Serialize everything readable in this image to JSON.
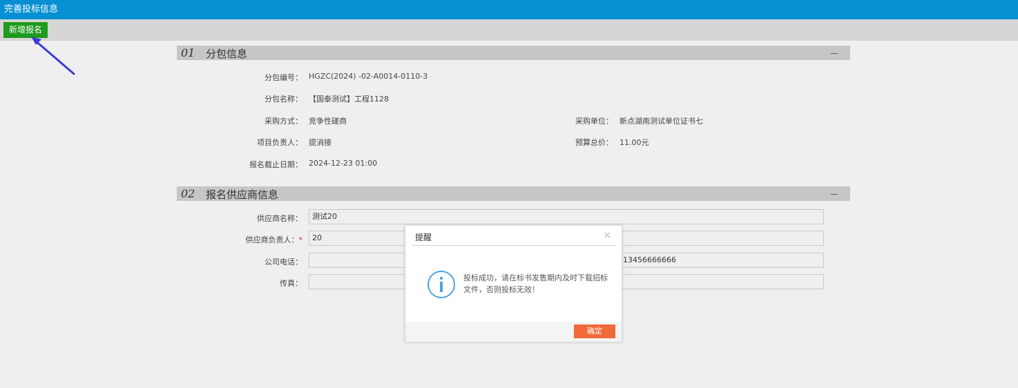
{
  "header": {
    "title": "完善投标信息"
  },
  "toolbar": {
    "add_label": "新增报名"
  },
  "section1": {
    "num": "01",
    "title": "分包信息",
    "collapse": "—",
    "fields": {
      "package_no_label": "分包编号：",
      "package_no": "HGZC(2024) -02-A0014-0110-3",
      "package_name_label": "分包名称：",
      "package_name": "【国泰测试】工程1128",
      "method_label": "采购方式：",
      "method": "竞争性磋商",
      "buyer_label": "采购单位：",
      "buyer": "新点湖南测试单位证书七",
      "manager_label": "项目负责人：",
      "manager": "提消接",
      "budget_label": "预算总价：",
      "budget": "11.00元",
      "deadline_label": "报名截止日期：",
      "deadline": "2024-12-23 01:00"
    }
  },
  "section2": {
    "num": "02",
    "title": "报名供应商信息",
    "collapse": "—",
    "fields": {
      "supplier_name_label": "供应商名称：",
      "supplier_name": "测试20",
      "supplier_contact_label": "供应商负责人：",
      "required_mark": "*",
      "supplier_contact": "20",
      "company_phone_label": "公司电话：",
      "company_phone": "",
      "mobile": "13456666666",
      "fax_label": "传真：",
      "fax": ""
    }
  },
  "dialog": {
    "title": "提醒",
    "close": "×",
    "message": "投标成功，请在标书发售期内及时下载招标文件，否则投标无效！",
    "ok_label": "确定"
  },
  "colors": {
    "header_bg": "#0590d3",
    "add_button": "#1e9a1e",
    "ok_button": "#f06a3a",
    "info_icon": "#4aa3df",
    "arrow": "#3a3ad8"
  }
}
